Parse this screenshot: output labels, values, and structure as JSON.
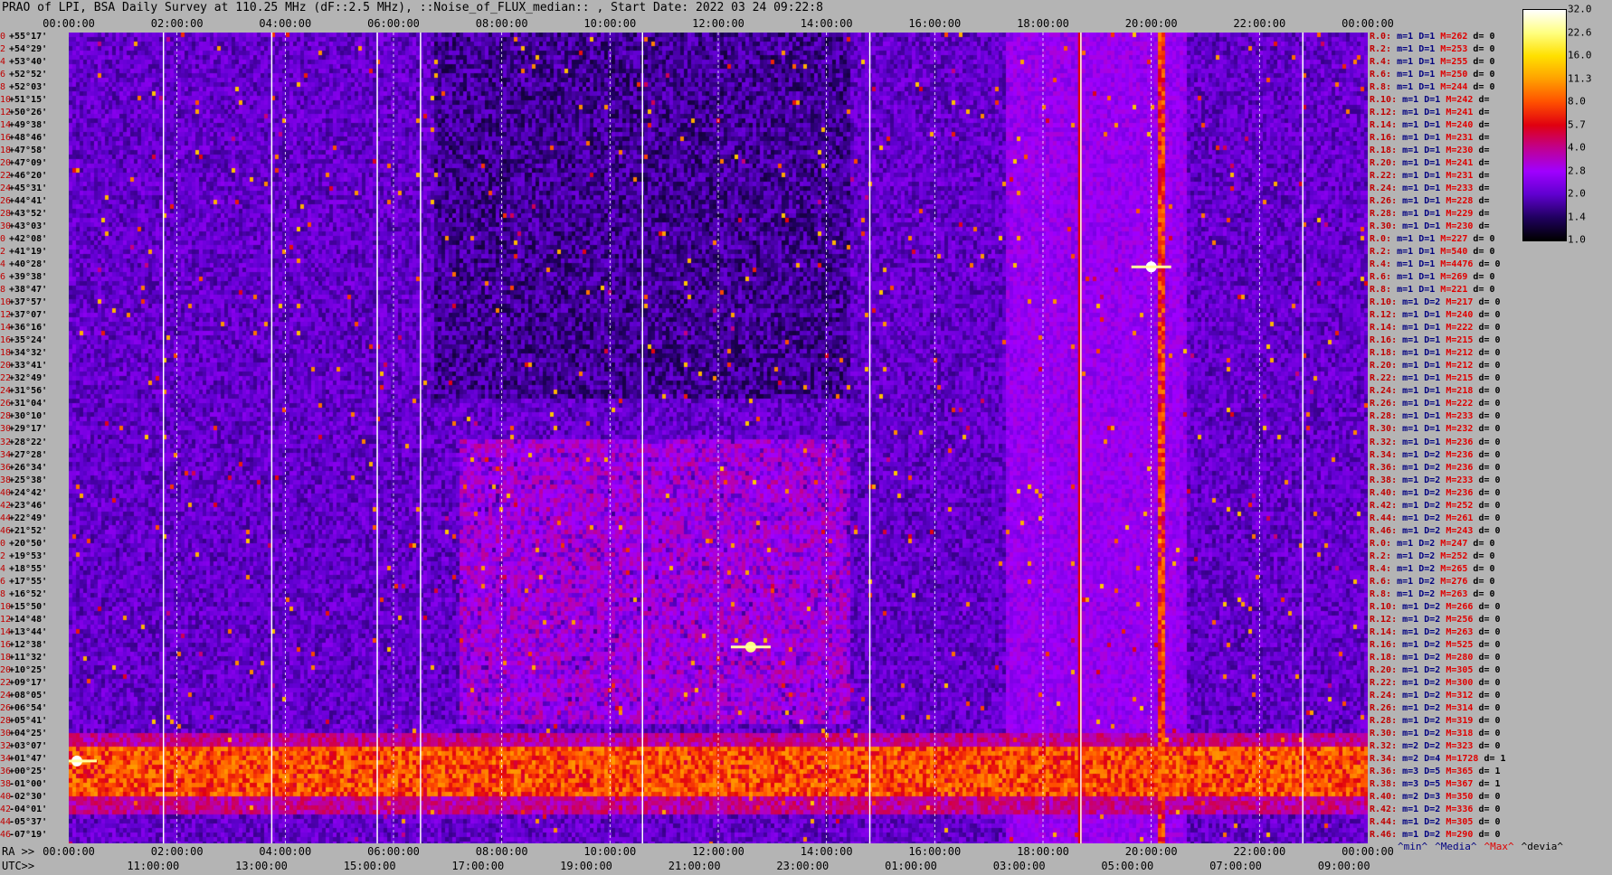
{
  "title": "PRAO of LPI, BSA Daily Survey at 110.25 MHz (dF::2.5 MHz), ::Noise_of_FLUX_median:: , Start Date: 2022 03 24 09:22:8",
  "top_ticks": [
    "00:00:00",
    "02:00:00",
    "04:00:00",
    "06:00:00",
    "08:00:00",
    "10:00:00",
    "12:00:00",
    "14:00:00",
    "16:00:00",
    "18:00:00",
    "20:00:00",
    "22:00:00",
    "00:00:00"
  ],
  "bottom_prefix_ra": "RA >>",
  "bottom_ticks_ra": [
    "00:00:00",
    "02:00:00",
    "04:00:00",
    "06:00:00",
    "08:00:00",
    "10:00:00",
    "12:00:00",
    "14:00:00",
    "16:00:00",
    "18:00:00",
    "20:00:00",
    "22:00:00",
    "00:00:00"
  ],
  "bottom_prefix_utc": "UTC>>",
  "bottom_ticks_utc": [
    "11:00:00",
    "13:00:00",
    "15:00:00",
    "17:00:00",
    "19:00:00",
    "21:00:00",
    "23:00:00",
    "01:00:00",
    "03:00:00",
    "05:00:00",
    "07:00:00",
    "09:00:00"
  ],
  "colorbar": {
    "ticks": [
      "32.0",
      "22.6",
      "16.0",
      "11.3",
      "8.0",
      "5.7",
      "4.0",
      "2.8",
      "2.0",
      "1.4",
      "1.0"
    ],
    "colors": [
      "#ffffff",
      "#ffff80",
      "#ffe000",
      "#ffa000",
      "#ff5000",
      "#e00010",
      "#c00090",
      "#a000ff",
      "#6000d0",
      "#200060",
      "#000000"
    ]
  },
  "legend_footer": [
    {
      "text": "^min^",
      "color": "#000080"
    },
    {
      "text": "^Media^",
      "color": "#000080"
    },
    {
      "text": "^Max^",
      "color": "#e00000"
    },
    {
      "text": "^devia^",
      "color": "#000000"
    }
  ],
  "declinations": [
    {
      "i": "0",
      "dec": "+55°17'"
    },
    {
      "i": "2",
      "dec": "+54°29'"
    },
    {
      "i": "4",
      "dec": "+53°40'"
    },
    {
      "i": "6",
      "dec": "+52°52'"
    },
    {
      "i": "8",
      "dec": "+52°03'"
    },
    {
      "i": "10",
      "dec": "+51°15'"
    },
    {
      "i": "12",
      "dec": "+50°26'"
    },
    {
      "i": "14",
      "dec": "+49°38'"
    },
    {
      "i": "16",
      "dec": "+48°46'"
    },
    {
      "i": "18",
      "dec": "+47°58'"
    },
    {
      "i": "20",
      "dec": "+47°09'"
    },
    {
      "i": "22",
      "dec": "+46°20'"
    },
    {
      "i": "24",
      "dec": "+45°31'"
    },
    {
      "i": "26",
      "dec": "+44°41'"
    },
    {
      "i": "28",
      "dec": "+43°52'"
    },
    {
      "i": "30",
      "dec": "+43°03'"
    },
    {
      "i": "0",
      "dec": "+42°08'"
    },
    {
      "i": "2",
      "dec": "+41°19'"
    },
    {
      "i": "4",
      "dec": "+40°28'"
    },
    {
      "i": "6",
      "dec": "+39°38'"
    },
    {
      "i": "8",
      "dec": "+38°47'"
    },
    {
      "i": "10",
      "dec": "+37°57'"
    },
    {
      "i": "12",
      "dec": "+37°07'"
    },
    {
      "i": "14",
      "dec": "+36°16'"
    },
    {
      "i": "16",
      "dec": "+35°24'"
    },
    {
      "i": "18",
      "dec": "+34°32'"
    },
    {
      "i": "20",
      "dec": "+33°41'"
    },
    {
      "i": "22",
      "dec": "+32°49'"
    },
    {
      "i": "24",
      "dec": "+31°56'"
    },
    {
      "i": "26",
      "dec": "+31°04'"
    },
    {
      "i": "28",
      "dec": "+30°10'"
    },
    {
      "i": "30",
      "dec": "+29°17'"
    },
    {
      "i": "32",
      "dec": "+28°22'"
    },
    {
      "i": "34",
      "dec": "+27°28'"
    },
    {
      "i": "36",
      "dec": "+26°34'"
    },
    {
      "i": "38",
      "dec": "+25°38'"
    },
    {
      "i": "40",
      "dec": "+24°42'"
    },
    {
      "i": "42",
      "dec": "+23°46'"
    },
    {
      "i": "44",
      "dec": "+22°49'"
    },
    {
      "i": "46",
      "dec": "+21°52'"
    },
    {
      "i": "0",
      "dec": "+20°50'"
    },
    {
      "i": "2",
      "dec": "+19°53'"
    },
    {
      "i": "4",
      "dec": "+18°55'"
    },
    {
      "i": "6",
      "dec": "+17°55'"
    },
    {
      "i": "8",
      "dec": "+16°52'"
    },
    {
      "i": "10",
      "dec": "+15°50'"
    },
    {
      "i": "12",
      "dec": "+14°48'"
    },
    {
      "i": "14",
      "dec": "+13°44'"
    },
    {
      "i": "16",
      "dec": "+12°38'"
    },
    {
      "i": "18",
      "dec": "+11°32'"
    },
    {
      "i": "20",
      "dec": "+10°25'"
    },
    {
      "i": "22",
      "dec": "+09°17'"
    },
    {
      "i": "24",
      "dec": "+08°05'"
    },
    {
      "i": "26",
      "dec": "+06°54'"
    },
    {
      "i": "28",
      "dec": "+05°41'"
    },
    {
      "i": "30",
      "dec": "+04°25'"
    },
    {
      "i": "32",
      "dec": "+03°07'"
    },
    {
      "i": "34",
      "dec": "+01°47'"
    },
    {
      "i": "36",
      "dec": "+00°25'"
    },
    {
      "i": "38",
      "dec": "-01°00'"
    },
    {
      "i": "40",
      "dec": "-02°30'"
    },
    {
      "i": "42",
      "dec": "-04°01'"
    },
    {
      "i": "44",
      "dec": "-05°37'"
    },
    {
      "i": "46",
      "dec": "-07°19'"
    }
  ],
  "stats": [
    {
      "r": "R.0:",
      "m": "m=1",
      "d": "D=1",
      "mx": "M=262",
      "dd": "d= 0"
    },
    {
      "r": "R.2:",
      "m": "m=1",
      "d": "D=1",
      "mx": "M=253",
      "dd": "d= 0"
    },
    {
      "r": "R.4:",
      "m": "m=1",
      "d": "D=1",
      "mx": "M=255",
      "dd": "d= 0"
    },
    {
      "r": "R.6:",
      "m": "m=1",
      "d": "D=1",
      "mx": "M=250",
      "dd": "d= 0"
    },
    {
      "r": "R.8:",
      "m": "m=1",
      "d": "D=1",
      "mx": "M=244",
      "dd": "d= 0"
    },
    {
      "r": "R.10:",
      "m": "m=1",
      "d": "D=1",
      "mx": "M=242",
      "dd": "d="
    },
    {
      "r": "R.12:",
      "m": "m=1",
      "d": "D=1",
      "mx": "M=241",
      "dd": "d="
    },
    {
      "r": "R.14:",
      "m": "m=1",
      "d": "D=1",
      "mx": "M=240",
      "dd": "d="
    },
    {
      "r": "R.16:",
      "m": "m=1",
      "d": "D=1",
      "mx": "M=231",
      "dd": "d="
    },
    {
      "r": "R.18:",
      "m": "m=1",
      "d": "D=1",
      "mx": "M=230",
      "dd": "d="
    },
    {
      "r": "R.20:",
      "m": "m=1",
      "d": "D=1",
      "mx": "M=241",
      "dd": "d="
    },
    {
      "r": "R.22:",
      "m": "m=1",
      "d": "D=1",
      "mx": "M=231",
      "dd": "d="
    },
    {
      "r": "R.24:",
      "m": "m=1",
      "d": "D=1",
      "mx": "M=233",
      "dd": "d="
    },
    {
      "r": "R.26:",
      "m": "m=1",
      "d": "D=1",
      "mx": "M=228",
      "dd": "d="
    },
    {
      "r": "R.28:",
      "m": "m=1",
      "d": "D=1",
      "mx": "M=229",
      "dd": "d="
    },
    {
      "r": "R.30:",
      "m": "m=1",
      "d": "D=1",
      "mx": "M=230",
      "dd": "d="
    },
    {
      "r": "R.0:",
      "m": "m=1",
      "d": "D=1",
      "mx": "M=227",
      "dd": "d= 0"
    },
    {
      "r": "R.2:",
      "m": "m=1",
      "d": "D=1",
      "mx": "M=540",
      "dd": "d= 0"
    },
    {
      "r": "R.4:",
      "m": "m=1",
      "d": "D=1",
      "mx": "M=4476",
      "dd": "d= 0"
    },
    {
      "r": "R.6:",
      "m": "m=1",
      "d": "D=1",
      "mx": "M=269",
      "dd": "d= 0"
    },
    {
      "r": "R.8:",
      "m": "m=1",
      "d": "D=1",
      "mx": "M=221",
      "dd": "d= 0"
    },
    {
      "r": "R.10:",
      "m": "m=1",
      "d": "D=2",
      "mx": "M=217",
      "dd": "d= 0"
    },
    {
      "r": "R.12:",
      "m": "m=1",
      "d": "D=1",
      "mx": "M=240",
      "dd": "d= 0"
    },
    {
      "r": "R.14:",
      "m": "m=1",
      "d": "D=1",
      "mx": "M=222",
      "dd": "d= 0"
    },
    {
      "r": "R.16:",
      "m": "m=1",
      "d": "D=1",
      "mx": "M=215",
      "dd": "d= 0"
    },
    {
      "r": "R.18:",
      "m": "m=1",
      "d": "D=1",
      "mx": "M=212",
      "dd": "d= 0"
    },
    {
      "r": "R.20:",
      "m": "m=1",
      "d": "D=1",
      "mx": "M=212",
      "dd": "d= 0"
    },
    {
      "r": "R.22:",
      "m": "m=1",
      "d": "D=1",
      "mx": "M=215",
      "dd": "d= 0"
    },
    {
      "r": "R.24:",
      "m": "m=1",
      "d": "D=1",
      "mx": "M=218",
      "dd": "d= 0"
    },
    {
      "r": "R.26:",
      "m": "m=1",
      "d": "D=1",
      "mx": "M=222",
      "dd": "d= 0"
    },
    {
      "r": "R.28:",
      "m": "m=1",
      "d": "D=1",
      "mx": "M=233",
      "dd": "d= 0"
    },
    {
      "r": "R.30:",
      "m": "m=1",
      "d": "D=1",
      "mx": "M=232",
      "dd": "d= 0"
    },
    {
      "r": "R.32:",
      "m": "m=1",
      "d": "D=1",
      "mx": "M=236",
      "dd": "d= 0"
    },
    {
      "r": "R.34:",
      "m": "m=1",
      "d": "D=2",
      "mx": "M=236",
      "dd": "d= 0"
    },
    {
      "r": "R.36:",
      "m": "m=1",
      "d": "D=2",
      "mx": "M=236",
      "dd": "d= 0"
    },
    {
      "r": "R.38:",
      "m": "m=1",
      "d": "D=2",
      "mx": "M=233",
      "dd": "d= 0"
    },
    {
      "r": "R.40:",
      "m": "m=1",
      "d": "D=2",
      "mx": "M=236",
      "dd": "d= 0"
    },
    {
      "r": "R.42:",
      "m": "m=1",
      "d": "D=2",
      "mx": "M=252",
      "dd": "d= 0"
    },
    {
      "r": "R.44:",
      "m": "m=1",
      "d": "D=2",
      "mx": "M=261",
      "dd": "d= 0"
    },
    {
      "r": "R.46:",
      "m": "m=1",
      "d": "D=2",
      "mx": "M=243",
      "dd": "d= 0"
    },
    {
      "r": "R.0:",
      "m": "m=1",
      "d": "D=2",
      "mx": "M=247",
      "dd": "d= 0"
    },
    {
      "r": "R.2:",
      "m": "m=1",
      "d": "D=2",
      "mx": "M=252",
      "dd": "d= 0"
    },
    {
      "r": "R.4:",
      "m": "m=1",
      "d": "D=2",
      "mx": "M=265",
      "dd": "d= 0"
    },
    {
      "r": "R.6:",
      "m": "m=1",
      "d": "D=2",
      "mx": "M=276",
      "dd": "d= 0"
    },
    {
      "r": "R.8:",
      "m": "m=1",
      "d": "D=2",
      "mx": "M=263",
      "dd": "d= 0"
    },
    {
      "r": "R.10:",
      "m": "m=1",
      "d": "D=2",
      "mx": "M=266",
      "dd": "d= 0"
    },
    {
      "r": "R.12:",
      "m": "m=1",
      "d": "D=2",
      "mx": "M=256",
      "dd": "d= 0"
    },
    {
      "r": "R.14:",
      "m": "m=1",
      "d": "D=2",
      "mx": "M=263",
      "dd": "d= 0"
    },
    {
      "r": "R.16:",
      "m": "m=1",
      "d": "D=2",
      "mx": "M=525",
      "dd": "d= 0"
    },
    {
      "r": "R.18:",
      "m": "m=1",
      "d": "D=2",
      "mx": "M=280",
      "dd": "d= 0"
    },
    {
      "r": "R.20:",
      "m": "m=1",
      "d": "D=2",
      "mx": "M=305",
      "dd": "d= 0"
    },
    {
      "r": "R.22:",
      "m": "m=1",
      "d": "D=2",
      "mx": "M=300",
      "dd": "d= 0"
    },
    {
      "r": "R.24:",
      "m": "m=1",
      "d": "D=2",
      "mx": "M=312",
      "dd": "d= 0"
    },
    {
      "r": "R.26:",
      "m": "m=1",
      "d": "D=2",
      "mx": "M=314",
      "dd": "d= 0"
    },
    {
      "r": "R.28:",
      "m": "m=1",
      "d": "D=2",
      "mx": "M=319",
      "dd": "d= 0"
    },
    {
      "r": "R.30:",
      "m": "m=1",
      "d": "D=2",
      "mx": "M=318",
      "dd": "d= 0"
    },
    {
      "r": "R.32:",
      "m": "m=2",
      "d": "D=2",
      "mx": "M=323",
      "dd": "d= 0"
    },
    {
      "r": "R.34:",
      "m": "m=2",
      "d": "D=4",
      "mx": "M=1728",
      "dd": "d= 1"
    },
    {
      "r": "R.36:",
      "m": "m=3",
      "d": "D=5",
      "mx": "M=365",
      "dd": "d= 1"
    },
    {
      "r": "R.38:",
      "m": "m=3",
      "d": "D=5",
      "mx": "M=367",
      "dd": "d= 1"
    },
    {
      "r": "R.40:",
      "m": "m=2",
      "d": "D=3",
      "mx": "M=350",
      "dd": "d= 0"
    },
    {
      "r": "R.42:",
      "m": "m=1",
      "d": "D=2",
      "mx": "M=336",
      "dd": "d= 0"
    },
    {
      "r": "R.44:",
      "m": "m=1",
      "d": "D=2",
      "mx": "M=305",
      "dd": "d= 0"
    },
    {
      "r": "R.46:",
      "m": "m=1",
      "d": "D=2",
      "mx": "M=290",
      "dd": "d= 0"
    }
  ],
  "chart_data": {
    "type": "heatmap",
    "title": "PRAO of LPI, BSA Daily Survey at 110.25 MHz (dF::2.5 MHz), ::Noise_of_FLUX_median:: , Start Date: 2022 03 24 09:22:8",
    "x_axis": "RA 00:00:00 to 24:00:00",
    "y_axis": "Declination +55°17' to -07°19'",
    "value_scale": "log",
    "vmin": 1.0,
    "vmax": 32.0,
    "vertical_lines_ra_hours": [
      1.75,
      3.75,
      5.7,
      6.5,
      10.6,
      14.8,
      18.7,
      22.8
    ],
    "features": [
      {
        "label": "bright source",
        "ra_h": 20.0,
        "dec": "+40°28'",
        "level": 32.0
      },
      {
        "label": "bright band",
        "dec_range": [
          "+01°47'",
          "-01°00'"
        ],
        "level": 8.0
      },
      {
        "label": "bright source",
        "ra_h": 12.6,
        "dec": "+12°38'",
        "level": 22.6
      },
      {
        "label": "bright source",
        "ra_h": 0.15,
        "dec": "+01°47'",
        "level": 32.0
      }
    ]
  }
}
